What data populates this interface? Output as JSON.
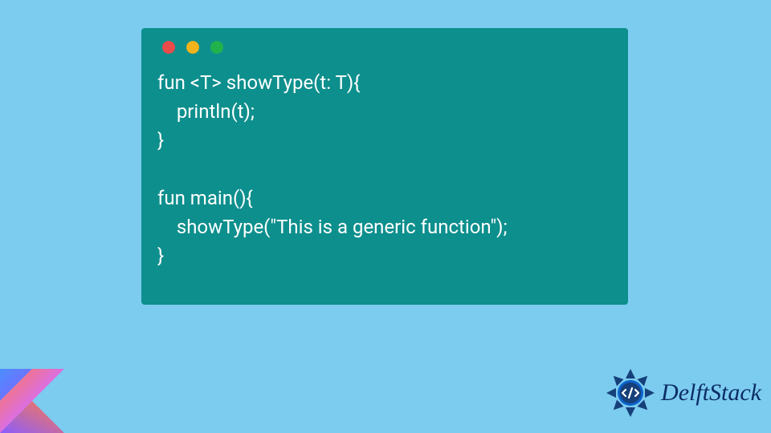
{
  "code": {
    "lines": [
      "fun <T> showType(t: T){",
      "    println(t);",
      "}",
      "",
      "fun main(){",
      "    showType(\"This is a generic function\");",
      "}"
    ]
  },
  "brand": {
    "name": "DelftStack"
  }
}
